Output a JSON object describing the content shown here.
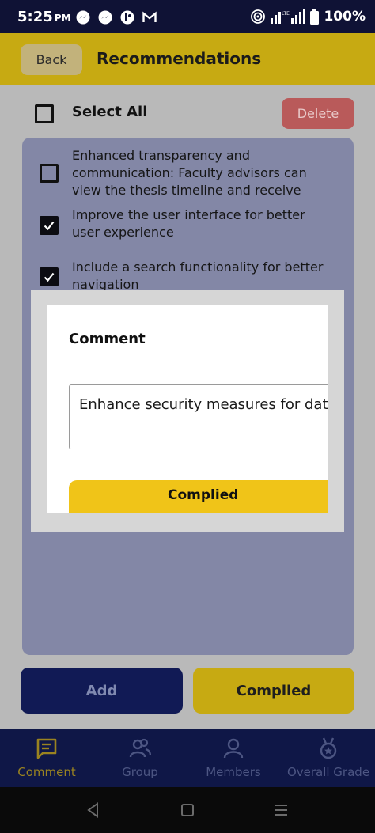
{
  "status_bar": {
    "time": "5:25",
    "ampm": "PM",
    "battery": "100%",
    "notification_icons": [
      "messenger-icon",
      "messenger-icon",
      "app-icon",
      "gmail-icon"
    ]
  },
  "header": {
    "back_label": "Back",
    "title": "Recommendations"
  },
  "toolbar": {
    "select_all_label": "Select All",
    "delete_label": "Delete"
  },
  "recommendations": [
    {
      "text": "Enhanced transparency and communication: Faculty advisors can view the thesis timeline and receive",
      "checked": false
    },
    {
      "text": "Improve the user interface for better user experience",
      "checked": true
    },
    {
      "text": "Include a search functionality for better navigation",
      "checked": true
    }
  ],
  "actions": {
    "add_label": "Add",
    "complied_label": "Complied"
  },
  "bottom_nav": [
    {
      "label": "Comment",
      "icon": "comment-icon",
      "active": true
    },
    {
      "label": "Group",
      "icon": "group-icon",
      "active": false
    },
    {
      "label": "Members",
      "icon": "person-icon",
      "active": false
    },
    {
      "label": "Overall Grade",
      "icon": "medal-icon",
      "active": false
    }
  ],
  "modal": {
    "title": "Comment",
    "comment_value": "Enhance security measures for data",
    "button_label": "Complied"
  },
  "colors": {
    "header_yellow": "#c7aa12",
    "navy": "#0f1747",
    "modal_button_yellow": "#f0c418",
    "delete_red": "#b95a5a"
  }
}
